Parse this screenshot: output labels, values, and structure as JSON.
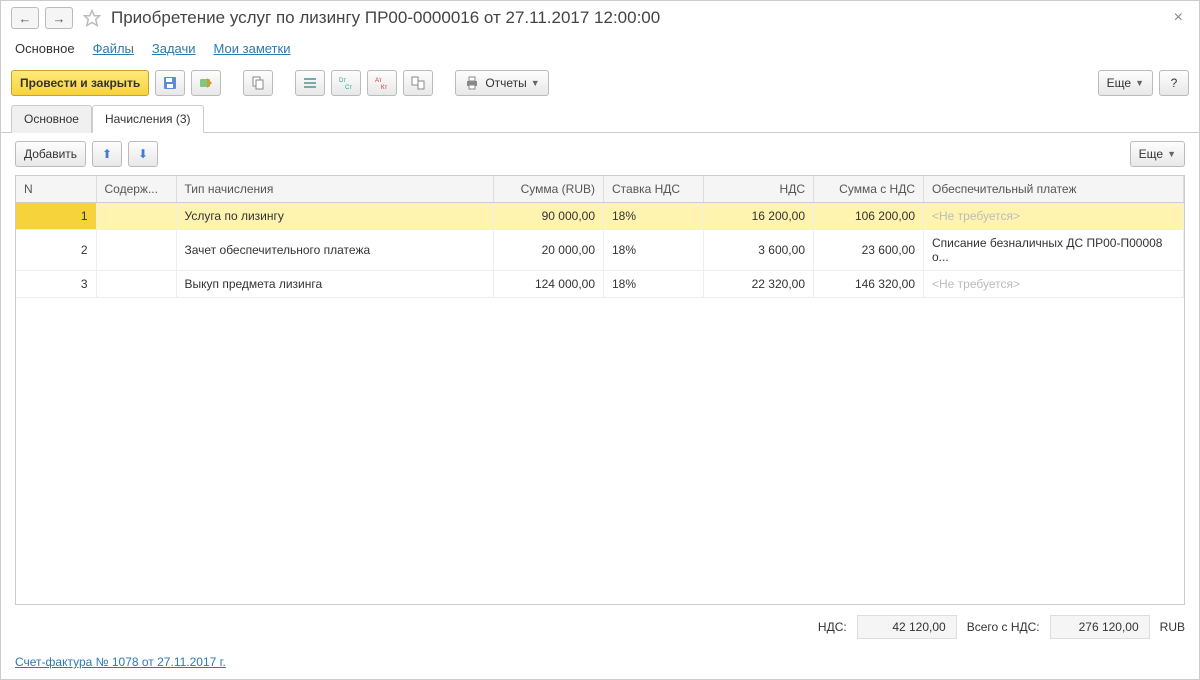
{
  "title": "Приобретение услуг по лизингу ПР00-0000016 от 27.11.2017 12:00:00",
  "links": {
    "main": "Основное",
    "files": "Файлы",
    "tasks": "Задачи",
    "notes": "Мои заметки"
  },
  "buttons": {
    "post_close": "Провести и закрыть",
    "reports": "Отчеты",
    "more": "Еще",
    "help": "?",
    "add": "Добавить"
  },
  "tabs": {
    "main": "Основное",
    "accruals": "Начисления (3)"
  },
  "columns": {
    "n": "N",
    "content": "Содерж...",
    "type": "Тип начисления",
    "sum": "Сумма (RUB)",
    "vat_rate": "Ставка НДС",
    "vat": "НДС",
    "sum_vat": "Сумма с НДС",
    "deposit": "Обеспечительный платеж"
  },
  "rows": [
    {
      "n": "1",
      "content": "",
      "type": "Услуга по лизингу",
      "sum": "90 000,00",
      "vat_rate": "18%",
      "vat": "16 200,00",
      "sum_vat": "106 200,00",
      "deposit": "<Не требуется>",
      "deposit_ph": true,
      "sel": true
    },
    {
      "n": "2",
      "content": "",
      "type": "Зачет обеспечительного платежа",
      "sum": "20 000,00",
      "vat_rate": "18%",
      "vat": "3 600,00",
      "sum_vat": "23 600,00",
      "deposit": "Списание безналичных ДС ПР00-П00008 о...",
      "deposit_ph": false
    },
    {
      "n": "3",
      "content": "",
      "type": "Выкуп предмета лизинга",
      "sum": "124 000,00",
      "vat_rate": "18%",
      "vat": "22 320,00",
      "sum_vat": "146 320,00",
      "deposit": "<Не требуется>",
      "deposit_ph": true
    }
  ],
  "footer": {
    "vat_label": "НДС:",
    "vat_val": "42 120,00",
    "total_label": "Всего с НДС:",
    "total_val": "276 120,00",
    "currency": "RUB"
  },
  "invoice_link": "Счет-фактура № 1078 от 27.11.2017 г."
}
